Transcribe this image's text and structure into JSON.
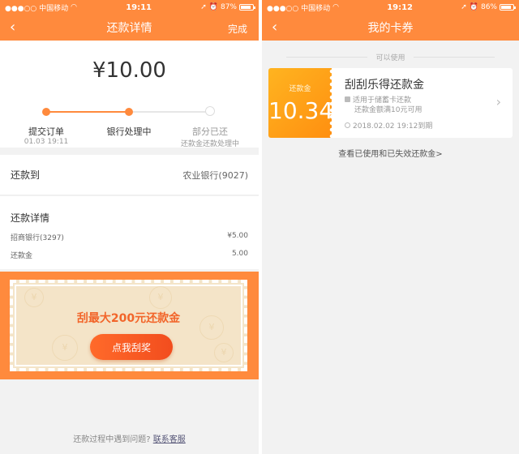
{
  "left": {
    "status": {
      "carrier": "●●●○○ 中国移动",
      "time": "19:11",
      "battery": "87%",
      "battery_level": 0.87
    },
    "nav": {
      "back": "‹",
      "title": "还款详情",
      "done": "完成"
    },
    "amount": "¥10.00",
    "steps": [
      {
        "label": "提交订单",
        "sub": "01.03 19:11"
      },
      {
        "label": "银行处理中",
        "sub": ""
      },
      {
        "label": "部分已还",
        "sub": "还款金还款处理中"
      }
    ],
    "repay_to": {
      "label": "还款到",
      "value": "农业银行(9027)"
    },
    "detail": {
      "title": "还款详情",
      "lines": [
        {
          "label": "招商银行(3297)",
          "value": "¥5.00"
        },
        {
          "label": "还款金",
          "value": "5.00"
        }
      ]
    },
    "scratch": {
      "title": "刮最大200元还款金",
      "button": "点我刮奖",
      "coin_glyph": "¥"
    },
    "help": {
      "text": "还款过程中遇到问题?",
      "link": "联系客服"
    }
  },
  "right": {
    "status": {
      "carrier": "●●●○○ 中国移动",
      "time": "19:12",
      "battery": "86%",
      "battery_level": 0.86
    },
    "nav": {
      "back": "‹",
      "title": "我的卡券"
    },
    "section": "可以使用",
    "coupon": {
      "stub_label": "还款金",
      "value": "10.34",
      "title": "刮刮乐得还款金",
      "line1": "适用于储蓄卡还款",
      "line2": "还款金额满10元可用",
      "expiry": "2018.02.02 19:12到期",
      "chevron": "›"
    },
    "more_link": "查看已使用和已失效还款金>"
  },
  "colors": {
    "accent": "#ff8a3d",
    "coupon": "#ffa51a",
    "scratch_text": "#f2652a"
  },
  "icons": [
    "back-chevron-icon",
    "wifi-icon",
    "location-icon",
    "alarm-icon",
    "battery-icon",
    "lock-icon",
    "clock-icon",
    "chevron-right-icon"
  ]
}
